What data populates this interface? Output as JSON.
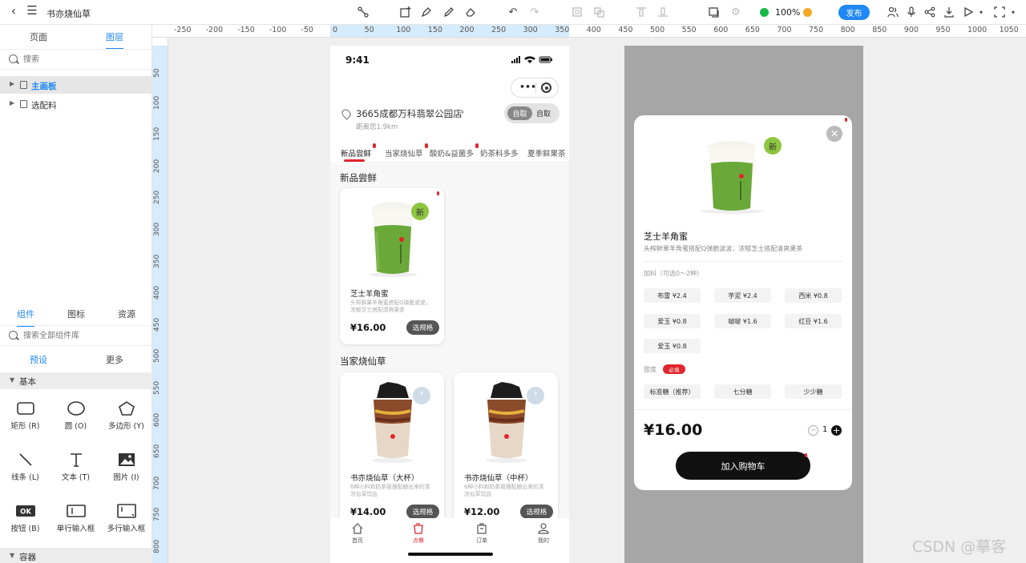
{
  "toolbar": {
    "doc_title": "书亦烧仙草",
    "zoom": "100%",
    "publish": "发布"
  },
  "left_panel": {
    "tabs": [
      "页面",
      "图层"
    ],
    "layer_search_placeholder": "搜索",
    "layers": [
      {
        "label": "主画板",
        "selected": true
      },
      {
        "label": "选配料",
        "selected": false
      }
    ],
    "component_tabs": [
      "组件",
      "图标",
      "资源"
    ],
    "component_search_placeholder": "搜索全部组件库",
    "sub_tabs": [
      "预设",
      "更多"
    ],
    "section_basic": "基本",
    "section_container": "容器",
    "components": [
      {
        "label": "矩形 (R)",
        "icon": "rectangle-icon"
      },
      {
        "label": "圆 (O)",
        "icon": "circle-icon"
      },
      {
        "label": "多边形 (Y)",
        "icon": "polygon-icon"
      },
      {
        "label": "线条 (L)",
        "icon": "line-icon"
      },
      {
        "label": "文本 (T)",
        "icon": "text-icon"
      },
      {
        "label": "图片 (I)",
        "icon": "image-icon"
      },
      {
        "label": "按钮 (B)",
        "icon": "button-icon",
        "badge": "OK"
      },
      {
        "label": "单行输入框",
        "icon": "single-input-icon"
      },
      {
        "label": "多行输入框",
        "icon": "multi-input-icon"
      }
    ]
  },
  "ruler": {
    "top_labels": [
      "-250",
      "-200",
      "-150",
      "-100",
      "-50",
      "0",
      "50",
      "100",
      "150",
      "200",
      "250",
      "300",
      "350",
      "400",
      "450",
      "500",
      "550",
      "600",
      "650",
      "700",
      "750",
      "800",
      "850",
      "900",
      "950",
      "1000",
      "1050"
    ],
    "left_labels": [
      "50",
      "100",
      "150",
      "200",
      "250",
      "300",
      "350",
      "400",
      "450",
      "500",
      "550",
      "600",
      "650",
      "700",
      "750",
      "800"
    ]
  },
  "phone": {
    "time": "9:41",
    "store_name": "3665成都万科翡翠公园店",
    "store_distance": "距离您1.9km",
    "toggle_on": "自取",
    "toggle_off": "自取",
    "categories": [
      "新品尝鲜",
      "当家烧仙草",
      "酸奶&益菌多",
      "奶茶料多多",
      "夏季鲜果茶"
    ],
    "section1_title": "新品尝鲜",
    "section2_title": "当家烧仙草",
    "new_badge": "新",
    "products": [
      {
        "name": "芝士羊角蜜",
        "desc": "头榨鲜果羊角蜜搭配Q弹脆波波，浓郁芝士搭配清爽果茶",
        "price": "¥16.00",
        "button": "选规格"
      },
      {
        "name": "书亦烧仙草（大杯）",
        "desc": "6种小料和奶茶碰撞酝酿出来的清凉仙草饮品",
        "price": "¥14.00",
        "button": "选规格"
      },
      {
        "name": "书亦烧仙草（中杯）",
        "desc": "6种小料和奶茶碰撞酝酿出来的清凉仙草饮品",
        "price": "¥12.00",
        "button": "选规格"
      }
    ],
    "tabbar": [
      "首页",
      "点餐",
      "订单",
      "我的"
    ]
  },
  "sheet": {
    "title": "芝士羊角蜜",
    "desc": "头榨鲜果羊角蜜搭配Q弹脆波波，浓郁芝士搭配清爽果茶",
    "new_badge": "新",
    "extras_title": "加料（可选0～2种）",
    "extras": [
      "布雷 ¥2.4",
      "芋泥 ¥2.4",
      "西米 ¥0.8",
      "爱玉 ¥0.8",
      "啵啵 ¥1.6",
      "红豆 ¥1.6",
      "爱玉 ¥0.8"
    ],
    "sweet_title": "甜度",
    "required": "必填",
    "sweet_options": [
      "标准糖（推荐）",
      "七分糖",
      "少少糖"
    ],
    "price": "¥16.00",
    "quantity": "1",
    "cart_button": "加入购物车"
  },
  "watermark": "CSDN @摹客",
  "colors": {
    "accent": "#1e88f5",
    "brand_red": "#e0262c",
    "matcha": "#6aa83a"
  }
}
